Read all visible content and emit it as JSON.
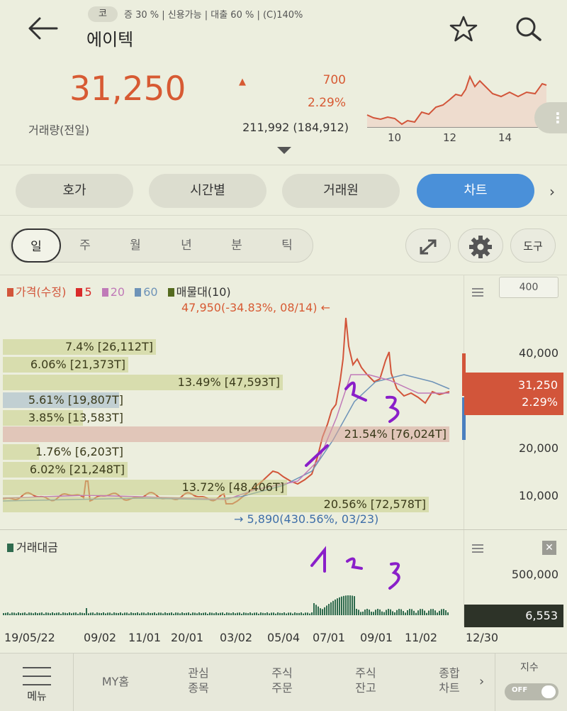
{
  "header": {
    "market_badge": "코",
    "info_line": "증 30 % | 신용가능 | 대출 60 % | (C)140%",
    "stock_name": "에이텍"
  },
  "quote": {
    "price": "31,250",
    "change": "700",
    "change_pct": "2.29%",
    "volume_label": "거래량(전일)",
    "volume_value": "211,992 (184,912)",
    "mini_x_ticks": [
      "10",
      "12",
      "14"
    ],
    "more_label": "⋮"
  },
  "tabs": [
    "호가",
    "시간별",
    "거래원",
    "차트"
  ],
  "active_tab": "차트",
  "periods": [
    "일",
    "주",
    "월",
    "년",
    "분",
    "틱"
  ],
  "active_period": "일",
  "tool_label": "도구",
  "legend": {
    "price": "가격(수정)",
    "ma5": "5",
    "ma20": "20",
    "ma60": "60",
    "volume_profile": "매물대(10)"
  },
  "colors": {
    "price": "#d2553a",
    "ma5": "#d92b2b",
    "ma20": "#c07ab8",
    "ma60": "#6e93b8",
    "volume_profile": "#556b1f",
    "volume": "#2f6b4e"
  },
  "annotations": {
    "high": "47,950(-34.83%, 08/14) ←",
    "low": "→ 5,890(430.56%, 03/23)"
  },
  "volume_profile": [
    {
      "label": "7.4% [26,112T]",
      "pct": 7.4
    },
    {
      "label": "6.06% [21,373T]",
      "pct": 6.06
    },
    {
      "label": "13.49% [47,593T]",
      "pct": 13.49
    },
    {
      "label": "5.61% [19,807T]",
      "pct": 5.61
    },
    {
      "label": "3.85% [13,583T]",
      "pct": 3.85
    },
    {
      "label": "21.54% [76,024T]",
      "pct": 21.54
    },
    {
      "label": "1.76% [6,203T]",
      "pct": 1.76
    },
    {
      "label": "6.02% [21,248T]",
      "pct": 6.02
    },
    {
      "label": "13.72% [48,406T]",
      "pct": 13.72
    },
    {
      "label": "20.56% [72,578T]",
      "pct": 20.56
    }
  ],
  "y_axis": {
    "box_value": "400",
    "ticks": [
      "40,000",
      "20,000",
      "10,000"
    ],
    "current_price": "31,250",
    "current_pct": "2.29%"
  },
  "sub_chart": {
    "legend": "거래대금",
    "tick": "500,000",
    "current": "6,553"
  },
  "x_axis": [
    "19/05/22",
    "09/02",
    "11/01",
    "20/01",
    "03/02",
    "05/04",
    "07/01",
    "09/01",
    "11/02",
    "12/30"
  ],
  "bottom_nav": {
    "menu": "메뉴",
    "items": [
      {
        "l1": "MY홈",
        "l2": ""
      },
      {
        "l1": "관심",
        "l2": "종목"
      },
      {
        "l1": "주식",
        "l2": "주문"
      },
      {
        "l1": "주식",
        "l2": "잔고"
      },
      {
        "l1": "종합",
        "l2": "차트"
      }
    ],
    "index_label": "지수",
    "toggle": "OFF"
  }
}
